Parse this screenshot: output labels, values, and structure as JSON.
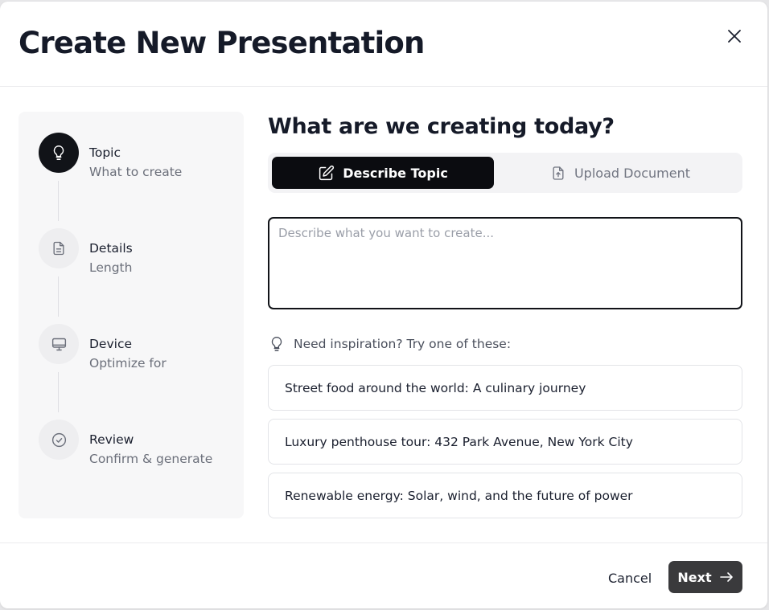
{
  "dialog": {
    "title": "Create New Presentation"
  },
  "steps": [
    {
      "title": "Topic",
      "subtitle": "What to create",
      "icon": "lightbulb-icon",
      "active": true
    },
    {
      "title": "Details",
      "subtitle": "Length",
      "icon": "document-icon",
      "active": false
    },
    {
      "title": "Device",
      "subtitle": "Optimize for",
      "icon": "monitor-icon",
      "active": false
    },
    {
      "title": "Review",
      "subtitle": "Confirm & generate",
      "icon": "check-circle-icon",
      "active": false
    }
  ],
  "main": {
    "heading": "What are we creating today?",
    "tabs": [
      {
        "label": "Describe Topic",
        "icon": "pencil-icon",
        "active": true
      },
      {
        "label": "Upload Document",
        "icon": "upload-file-icon",
        "active": false
      }
    ],
    "topic_input": {
      "value": "",
      "placeholder": "Describe what you want to create..."
    },
    "inspiration_label": "Need inspiration? Try one of these:",
    "suggestions": [
      "Street food around the world: A culinary journey",
      "Luxury penthouse tour: 432 Park Avenue, New York City",
      "Renewable energy: Solar, wind, and the future of power"
    ]
  },
  "footer": {
    "cancel_label": "Cancel",
    "next_label": "Next"
  },
  "colors": {
    "primary": "#0b0c10",
    "next_button": "#3a3a3c",
    "sidebar_bg": "#f7f7f8"
  }
}
